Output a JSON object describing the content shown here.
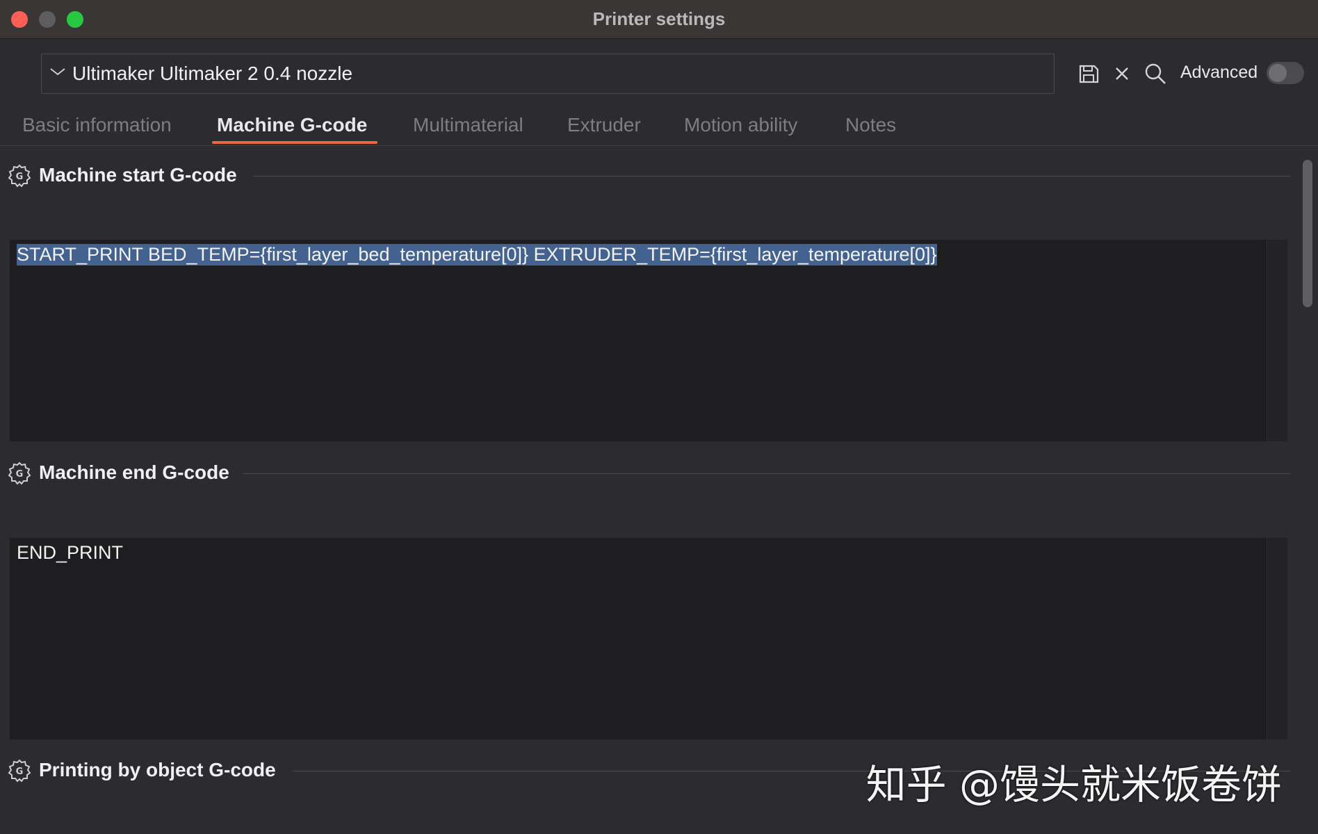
{
  "window": {
    "title": "Printer settings",
    "traffic_colors": {
      "close": "#ff5f57",
      "minimize": "#5d5d5f",
      "maximize": "#28c840"
    }
  },
  "preset": {
    "value": "Ultimaker Ultimaker 2 0.4 nozzle"
  },
  "toolbar": {
    "icons": [
      "save-icon",
      "close-icon",
      "search-icon"
    ],
    "advanced_label": "Advanced",
    "advanced_on": false
  },
  "tabs": [
    {
      "label": "Basic information",
      "active": false
    },
    {
      "label": "Machine G-code",
      "active": true
    },
    {
      "label": "Multimaterial",
      "active": false
    },
    {
      "label": "Extruder",
      "active": false
    },
    {
      "label": "Motion ability",
      "active": false
    },
    {
      "label": "Notes",
      "active": false
    }
  ],
  "accent_color": "#e86a3c",
  "sections": [
    {
      "title": "Machine start G-code",
      "code": "START_PRINT BED_TEMP={first_layer_bed_temperature[0]} EXTRUDER_TEMP={first_layer_temperature[0]}",
      "selected": true
    },
    {
      "title": "Machine end G-code",
      "code": "END_PRINT",
      "selected": false
    },
    {
      "title": "Printing by object G-code"
    }
  ],
  "watermark": "知乎 @馒头就米饭卷饼"
}
